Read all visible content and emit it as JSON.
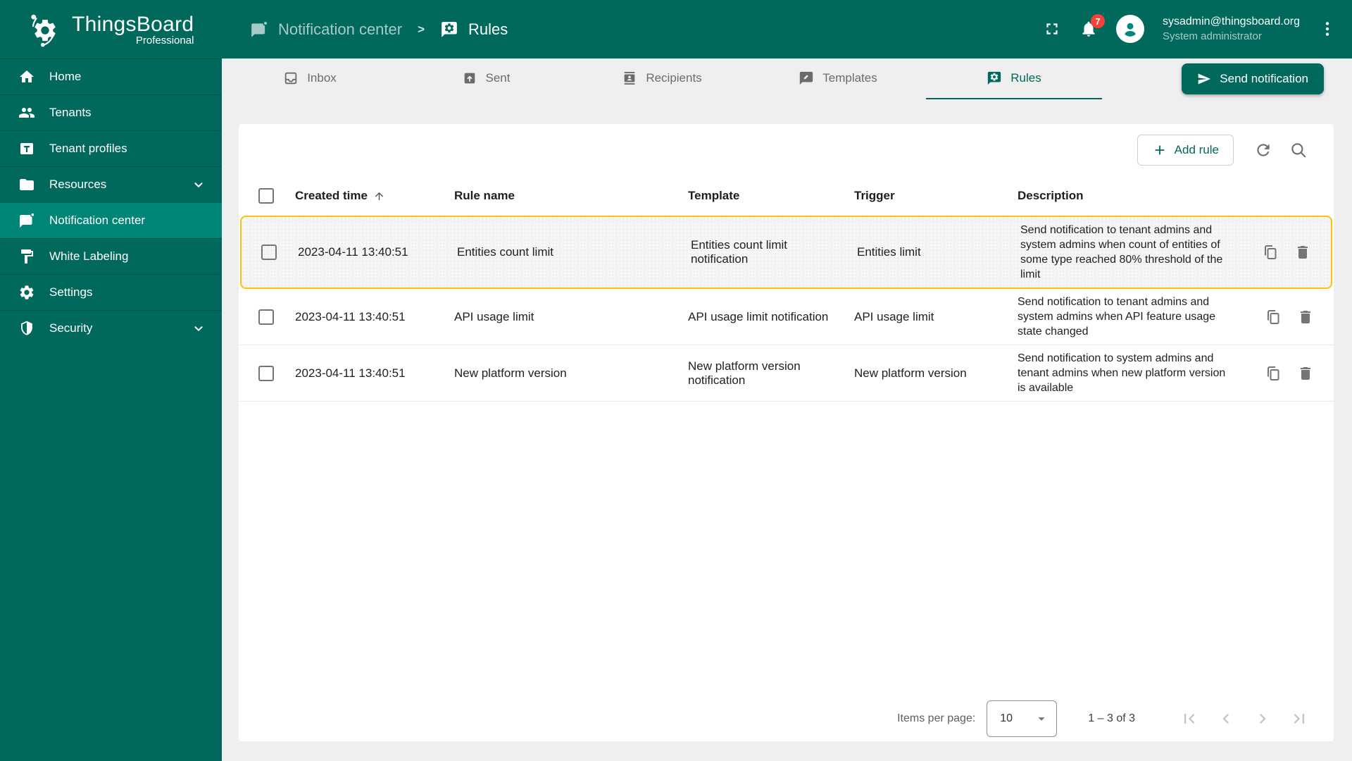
{
  "brand": {
    "name": "ThingsBoard",
    "edition": "Professional"
  },
  "sidebar": {
    "items": [
      {
        "label": "Home"
      },
      {
        "label": "Tenants"
      },
      {
        "label": "Tenant profiles"
      },
      {
        "label": "Resources"
      },
      {
        "label": "Notification center"
      },
      {
        "label": "White Labeling"
      },
      {
        "label": "Settings"
      },
      {
        "label": "Security"
      }
    ],
    "active_item": "Notification center"
  },
  "breadcrumb": {
    "parent": "Notification center",
    "separator": ">",
    "current": "Rules"
  },
  "topbar": {
    "notification_count": "7",
    "user_email": "sysadmin@thingsboard.org",
    "user_role": "System administrator"
  },
  "tabs": {
    "items": [
      {
        "label": "Inbox"
      },
      {
        "label": "Sent"
      },
      {
        "label": "Recipients"
      },
      {
        "label": "Templates"
      },
      {
        "label": "Rules"
      }
    ],
    "active": "Rules"
  },
  "toolbar": {
    "send_notification_label": "Send notification",
    "add_rule_label": "Add rule"
  },
  "table": {
    "headers": {
      "created_time": "Created time",
      "rule_name": "Rule name",
      "template": "Template",
      "trigger": "Trigger",
      "description": "Description"
    },
    "sort": {
      "column": "Created time",
      "direction": "asc"
    },
    "rows": [
      {
        "created_time": "2023-04-11 13:40:51",
        "rule_name": "Entities count limit",
        "template": "Entities count limit notification",
        "trigger": "Entities limit",
        "description": "Send notification to tenant admins and system admins when count of entities of some type reached 80% threshold of the limit",
        "selected": true
      },
      {
        "created_time": "2023-04-11 13:40:51",
        "rule_name": "API usage limit",
        "template": "API usage limit notification",
        "trigger": "API usage limit",
        "description": "Send notification to tenant admins and system admins when API feature usage state changed",
        "selected": false
      },
      {
        "created_time": "2023-04-11 13:40:51",
        "rule_name": "New platform version",
        "template": "New platform version notification",
        "trigger": "New platform version",
        "description": "Send notification to system admins and tenant admins when new platform version is available",
        "selected": false
      }
    ]
  },
  "pagination": {
    "items_per_page_label": "Items per page:",
    "items_per_page": "10",
    "range_label": "1 – 3 of 3"
  },
  "colors": {
    "primary": "#00695C",
    "sidebar_active": "#008577",
    "selected_row_border": "#FFC107",
    "notification_badge": "#F44336",
    "tab_background": "#EFEFEF"
  }
}
